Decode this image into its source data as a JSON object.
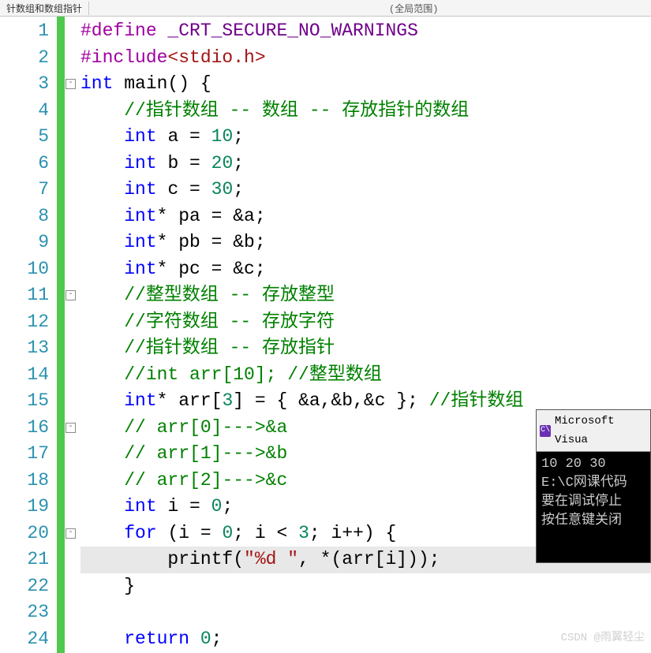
{
  "topbar": {
    "tab_label": "针数组和数组指针",
    "scope_label": "(全局范围)"
  },
  "fold_markers_lines": [
    3,
    11,
    16,
    20
  ],
  "code": {
    "lines": [
      {
        "n": 1,
        "tokens": [
          {
            "c": "pp",
            "t": "#define "
          },
          {
            "c": "mac",
            "t": "_CRT_SECURE_NO_WARNINGS"
          }
        ]
      },
      {
        "n": 2,
        "tokens": [
          {
            "c": "pp",
            "t": "#include"
          },
          {
            "c": "str",
            "t": "<stdio.h>"
          }
        ]
      },
      {
        "n": 3,
        "tokens": [
          {
            "c": "kw",
            "t": "int"
          },
          {
            "c": "txt",
            "t": " main() {"
          }
        ]
      },
      {
        "n": 4,
        "tokens": [
          {
            "c": "txt",
            "t": "    "
          },
          {
            "c": "cmt",
            "t": "//指针数组 -- 数组 -- 存放指针的数组"
          }
        ]
      },
      {
        "n": 5,
        "tokens": [
          {
            "c": "txt",
            "t": "    "
          },
          {
            "c": "kw",
            "t": "int"
          },
          {
            "c": "txt",
            "t": " a = "
          },
          {
            "c": "num",
            "t": "10"
          },
          {
            "c": "txt",
            "t": ";"
          }
        ]
      },
      {
        "n": 6,
        "tokens": [
          {
            "c": "txt",
            "t": "    "
          },
          {
            "c": "kw",
            "t": "int"
          },
          {
            "c": "txt",
            "t": " b = "
          },
          {
            "c": "num",
            "t": "20"
          },
          {
            "c": "txt",
            "t": ";"
          }
        ]
      },
      {
        "n": 7,
        "tokens": [
          {
            "c": "txt",
            "t": "    "
          },
          {
            "c": "kw",
            "t": "int"
          },
          {
            "c": "txt",
            "t": " c = "
          },
          {
            "c": "num",
            "t": "30"
          },
          {
            "c": "txt",
            "t": ";"
          }
        ]
      },
      {
        "n": 8,
        "tokens": [
          {
            "c": "txt",
            "t": "    "
          },
          {
            "c": "kw",
            "t": "int"
          },
          {
            "c": "txt",
            "t": "* pa = &a;"
          }
        ]
      },
      {
        "n": 9,
        "tokens": [
          {
            "c": "txt",
            "t": "    "
          },
          {
            "c": "kw",
            "t": "int"
          },
          {
            "c": "txt",
            "t": "* pb = &b;"
          }
        ]
      },
      {
        "n": 10,
        "tokens": [
          {
            "c": "txt",
            "t": "    "
          },
          {
            "c": "kw",
            "t": "int"
          },
          {
            "c": "txt",
            "t": "* pc = &c;"
          }
        ]
      },
      {
        "n": 11,
        "tokens": [
          {
            "c": "txt",
            "t": "    "
          },
          {
            "c": "cmt",
            "t": "//整型数组 -- 存放整型"
          }
        ]
      },
      {
        "n": 12,
        "tokens": [
          {
            "c": "txt",
            "t": "    "
          },
          {
            "c": "cmt",
            "t": "//字符数组 -- 存放字符"
          }
        ]
      },
      {
        "n": 13,
        "tokens": [
          {
            "c": "txt",
            "t": "    "
          },
          {
            "c": "cmt",
            "t": "//指针数组 -- 存放指针"
          }
        ]
      },
      {
        "n": 14,
        "tokens": [
          {
            "c": "txt",
            "t": "    "
          },
          {
            "c": "cmt",
            "t": "//int arr[10]; //整型数组"
          }
        ]
      },
      {
        "n": 15,
        "tokens": [
          {
            "c": "txt",
            "t": "    "
          },
          {
            "c": "kw",
            "t": "int"
          },
          {
            "c": "txt",
            "t": "* arr["
          },
          {
            "c": "num",
            "t": "3"
          },
          {
            "c": "txt",
            "t": "] = { &a,&b,&c }; "
          },
          {
            "c": "cmt",
            "t": "//指针数组"
          }
        ]
      },
      {
        "n": 16,
        "tokens": [
          {
            "c": "txt",
            "t": "    "
          },
          {
            "c": "cmt",
            "t": "// arr[0]--->&a"
          }
        ]
      },
      {
        "n": 17,
        "tokens": [
          {
            "c": "txt",
            "t": "    "
          },
          {
            "c": "cmt",
            "t": "// arr[1]--->&b"
          }
        ]
      },
      {
        "n": 18,
        "tokens": [
          {
            "c": "txt",
            "t": "    "
          },
          {
            "c": "cmt",
            "t": "// arr[2]--->&c"
          }
        ]
      },
      {
        "n": 19,
        "tokens": [
          {
            "c": "txt",
            "t": "    "
          },
          {
            "c": "kw",
            "t": "int"
          },
          {
            "c": "txt",
            "t": " i = "
          },
          {
            "c": "num",
            "t": "0"
          },
          {
            "c": "txt",
            "t": ";"
          }
        ]
      },
      {
        "n": 20,
        "tokens": [
          {
            "c": "txt",
            "t": "    "
          },
          {
            "c": "kw",
            "t": "for"
          },
          {
            "c": "txt",
            "t": " (i = "
          },
          {
            "c": "num",
            "t": "0"
          },
          {
            "c": "txt",
            "t": "; i < "
          },
          {
            "c": "num",
            "t": "3"
          },
          {
            "c": "txt",
            "t": "; i++) {"
          }
        ]
      },
      {
        "n": 21,
        "hl": true,
        "tokens": [
          {
            "c": "txt",
            "t": "        printf("
          },
          {
            "c": "str",
            "t": "\"%d \""
          },
          {
            "c": "txt",
            "t": ", *(arr[i]));"
          }
        ]
      },
      {
        "n": 22,
        "tokens": [
          {
            "c": "txt",
            "t": "    }"
          }
        ]
      },
      {
        "n": 23,
        "tokens": [
          {
            "c": "txt",
            "t": ""
          }
        ]
      },
      {
        "n": 24,
        "tokens": [
          {
            "c": "txt",
            "t": "    "
          },
          {
            "c": "kw",
            "t": "return"
          },
          {
            "c": "txt",
            "t": " "
          },
          {
            "c": "num",
            "t": "0"
          },
          {
            "c": "txt",
            "t": ";"
          }
        ]
      }
    ]
  },
  "console": {
    "title": "Microsoft Visua",
    "icon_text": "C\\",
    "lines": [
      "10 20 30",
      "E:\\C网课代码",
      "要在调试停止",
      "按任意键关闭"
    ]
  },
  "watermark": "CSDN @雨翼轻尘"
}
